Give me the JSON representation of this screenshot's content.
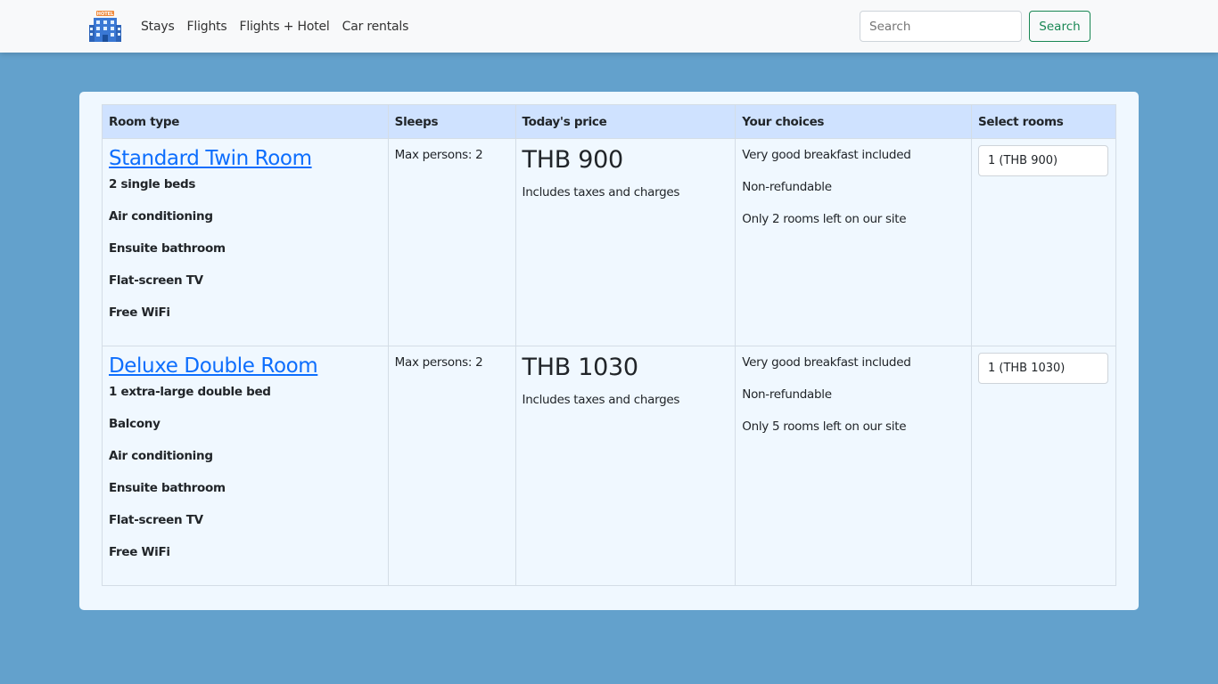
{
  "navbar": {
    "logo_icon": "hotel-building-icon",
    "links": [
      "Stays",
      "Flights",
      "Flights + Hotel",
      "Car rentals"
    ],
    "search_placeholder": "Search",
    "search_button": "Search",
    "search_button_color": "#198754"
  },
  "table": {
    "headers": [
      "Room type",
      "Sleeps",
      "Today's price",
      "Your choices",
      "Select rooms"
    ],
    "header_color": "#cfe2ff",
    "rows": [
      {
        "name": "Standard Twin Room",
        "features": [
          "2 single beds",
          "Air conditioning",
          "Ensuite bathroom",
          "Flat-screen TV",
          "Free WiFi"
        ],
        "sleeps": "Max persons: 2",
        "price": "THB 900",
        "price_note": "Includes taxes and charges",
        "choices": [
          "Very good breakfast included",
          "Non-refundable",
          "Only 2 rooms left on our site"
        ],
        "select_value": "1 (THB 900)"
      },
      {
        "name": "Deluxe Double Room",
        "features": [
          "1 extra-large double bed",
          "Balcony",
          "Air conditioning",
          "Ensuite bathroom",
          "Flat-screen TV",
          "Free WiFi"
        ],
        "sleeps": "Max persons: 2",
        "price": "THB 1030",
        "price_note": "Includes taxes and charges",
        "choices": [
          "Very good breakfast included",
          "Non-refundable",
          "Only 5 rooms left on our site"
        ],
        "select_value": "1 (THB 1030)"
      }
    ]
  }
}
